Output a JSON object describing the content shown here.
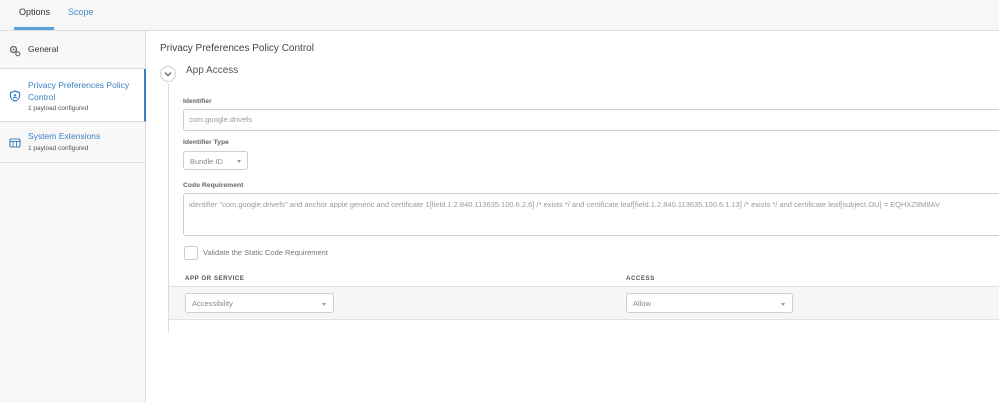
{
  "tabs": [
    {
      "label": "Options"
    },
    {
      "label": "Scope"
    }
  ],
  "sidebar": {
    "items": [
      {
        "label": "General",
        "subtitle": "",
        "icon": "gear-icon"
      },
      {
        "label": "Privacy Preferences Policy Control",
        "subtitle": "1 payload configured",
        "icon": "shield-icon"
      },
      {
        "label": "System Extensions",
        "subtitle": "1 payload configured",
        "icon": "extension-icon"
      }
    ]
  },
  "main": {
    "title": "Privacy Preferences Policy Control",
    "section_title": "App Access",
    "identifier": {
      "label": "Identifier",
      "value": "com.google.drivefs"
    },
    "identifier_type": {
      "label": "Identifier Type",
      "value": "Bundle ID"
    },
    "code_requirement": {
      "label": "Code Requirement",
      "value": "identifier \"com.google.drivefs\" and anchor apple generic and certificate 1[field.1.2.840.113635.100.6.2.6] /* exists */ and certificate leaf[field.1.2.840.113635.100.6.1.13] /* exists */ and certificate leaf[subject.OU] = EQHXZ8M8AV"
    },
    "validate_checkbox": {
      "label": "Validate the Static Code Requirement",
      "checked": false
    },
    "table": {
      "headers": [
        "APP OR SERVICE",
        "ACCESS"
      ],
      "rows": [
        {
          "service": "Accessibility",
          "access": "Allow"
        }
      ]
    }
  },
  "colors": {
    "accent": "#3c7fc2",
    "border": "#dcdcdc",
    "sidebar_bg": "#f8f8f8"
  }
}
